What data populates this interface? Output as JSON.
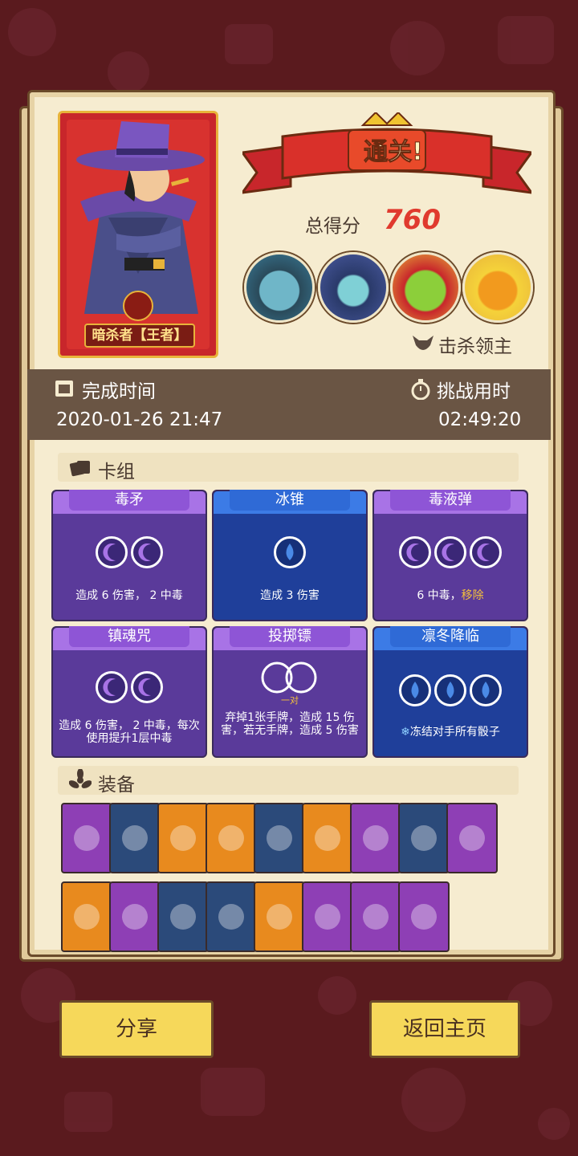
{
  "hero": {
    "label": "暗杀者【王者】"
  },
  "result": {
    "banner": "通关!",
    "score_label": "总得分",
    "score": "760",
    "kill_label": "击杀领主"
  },
  "bosses": [
    "blue-ogre-boss",
    "crowned-lich-boss",
    "green-goblin-king-boss",
    "pumpkin-sun-boss"
  ],
  "stats": {
    "finish_label": "完成时间",
    "finish_value": "2020-01-26 21:47",
    "duration_label": "挑战用时",
    "duration_value": "02:49:20"
  },
  "deck": {
    "title": "卡组",
    "cards": [
      {
        "name": "毒矛",
        "color": "purple",
        "dice": 2,
        "die_type": "moon",
        "desc": "造成 6 伤害， 2 中毒"
      },
      {
        "name": "冰锥",
        "color": "blue",
        "dice": 1,
        "die_type": "drop",
        "desc": "造成 3 伤害"
      },
      {
        "name": "毒液弹",
        "color": "purple",
        "dice": 3,
        "die_type": "moon",
        "desc_a": "6 中毒，",
        "desc_b": "移除"
      },
      {
        "name": "镇魂咒",
        "color": "purple",
        "dice": 2,
        "die_type": "moon",
        "desc": "造成 6 伤害， 2 中毒，每次使用提升1层中毒"
      },
      {
        "name": "投掷镖",
        "color": "purple",
        "dice": 0,
        "die_type": "pair",
        "pair_label": "一对",
        "desc": "弃掉1张手牌，造成 15 伤害，若无手牌，造成 5 伤害"
      },
      {
        "name": "凛冬降临",
        "color": "blue",
        "dice": 3,
        "die_type": "drop",
        "desc": "冻结对手所有骰子"
      }
    ]
  },
  "equipment": {
    "title": "装备",
    "row1": [
      {
        "icon": "parrot-icon",
        "bg": "#8e3fb5"
      },
      {
        "icon": "top-hat-icon",
        "bg": "#2b4a7a"
      },
      {
        "icon": "smoking-pipe-icon",
        "bg": "#e88a1e"
      },
      {
        "icon": "sun-badge-icon",
        "bg": "#e88a1e"
      },
      {
        "icon": "scroll-icon",
        "bg": "#2b4a7a"
      },
      {
        "icon": "skull-gem-icon",
        "bg": "#e88a1e"
      },
      {
        "icon": "feather-icon",
        "bg": "#8e3fb5"
      },
      {
        "icon": "leaf-bracelet-icon",
        "bg": "#2b4a7a"
      },
      {
        "icon": "potion-vase-icon",
        "bg": "#8e3fb5"
      }
    ],
    "row2": [
      {
        "icon": "spiked-bracelet-icon",
        "bg": "#e88a1e"
      },
      {
        "icon": "gold-coin-icon",
        "bg": "#8e3fb5"
      },
      {
        "icon": "heart-box-icon",
        "bg": "#2b4a7a"
      },
      {
        "icon": "skull-icon",
        "bg": "#2b4a7a"
      },
      {
        "icon": "fire-orb-icon",
        "bg": "#e88a1e"
      },
      {
        "icon": "green-orb-icon",
        "bg": "#8e3fb5"
      },
      {
        "icon": "skull-book-icon",
        "bg": "#8e3fb5"
      },
      {
        "icon": "chain-icon",
        "bg": "#8e3fb5"
      }
    ]
  },
  "buttons": {
    "share": "分享",
    "home": "返回主页"
  }
}
